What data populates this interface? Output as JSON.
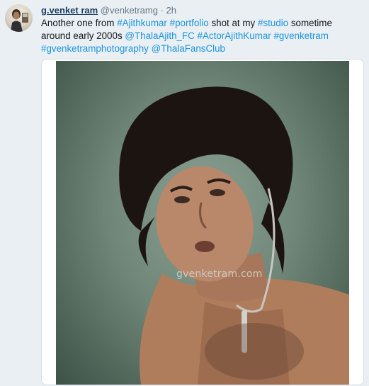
{
  "tweet": {
    "author_name": "g.venket ram",
    "handle": "@venketramg",
    "separator": "·",
    "time": "2h",
    "text": {
      "p1": "Another one from ",
      "tag_ajithkumar": "#Ajithkumar",
      "p2": " ",
      "tag_portfolio": "#portfolio",
      "p3": " shot at my ",
      "tag_studio": "#studio",
      "p4": " sometime around early 2000s ",
      "mention_thala": "@ThalaAjith_FC",
      "p5": " ",
      "tag_actor": "#ActorAjithKumar",
      "p6": " ",
      "tag_gvenketram": "#gvenketram",
      "p7": " ",
      "tag_photography": "#gvenketramphotography",
      "p8": " ",
      "mention_fans": "@ThalaFansClub"
    },
    "photo_watermark": "gvenketram.com"
  },
  "colors": {
    "link": "#1b95e0",
    "name": "#1d3f63",
    "muted": "#657786",
    "background": "#e9eff3"
  }
}
